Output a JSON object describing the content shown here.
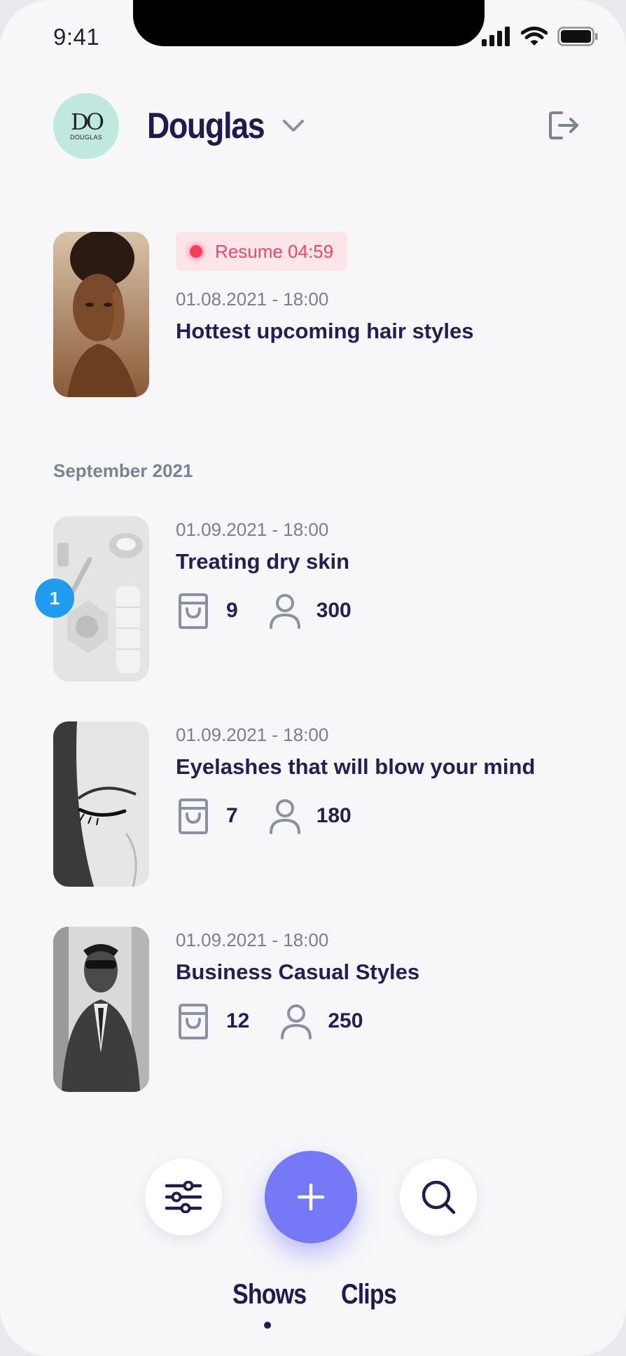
{
  "status_bar": {
    "time": "9:41"
  },
  "header": {
    "brand_monogram": "DO",
    "brand_wordmark": "DOUGLAS",
    "title": "Douglas"
  },
  "featured_show": {
    "resume_label": "Resume 04:59",
    "date": "01.08.2021 - 18:00",
    "title": "Hottest upcoming hair styles"
  },
  "section": {
    "label": "September 2021"
  },
  "shows": [
    {
      "date": "01.09.2021 - 18:00",
      "title": "Treating dry skin",
      "products": "9",
      "viewers": "300",
      "badge": "1"
    },
    {
      "date": "01.09.2021 - 18:00",
      "title": "Eyelashes that will blow your mind",
      "products": "7",
      "viewers": "180"
    },
    {
      "date": "01.09.2021 - 18:00",
      "title": "Business Casual Styles",
      "products": "12",
      "viewers": "250"
    }
  ],
  "bottom_tabs": [
    {
      "label": "Shows",
      "active": true
    },
    {
      "label": "Clips",
      "active": false
    }
  ],
  "icons": {
    "filter": "sliders-icon",
    "add": "plus-icon",
    "search": "search-icon",
    "logout": "logout-icon",
    "dropdown": "chevron-down-icon",
    "products": "shopping-bag-icon",
    "viewers": "person-icon"
  },
  "colors": {
    "primary": "#1f1a4f",
    "accent": "#7579f7",
    "live_red": "#ff3b5c",
    "badge_blue": "#1f9bf0",
    "brand_mint": "#bfe8df"
  }
}
